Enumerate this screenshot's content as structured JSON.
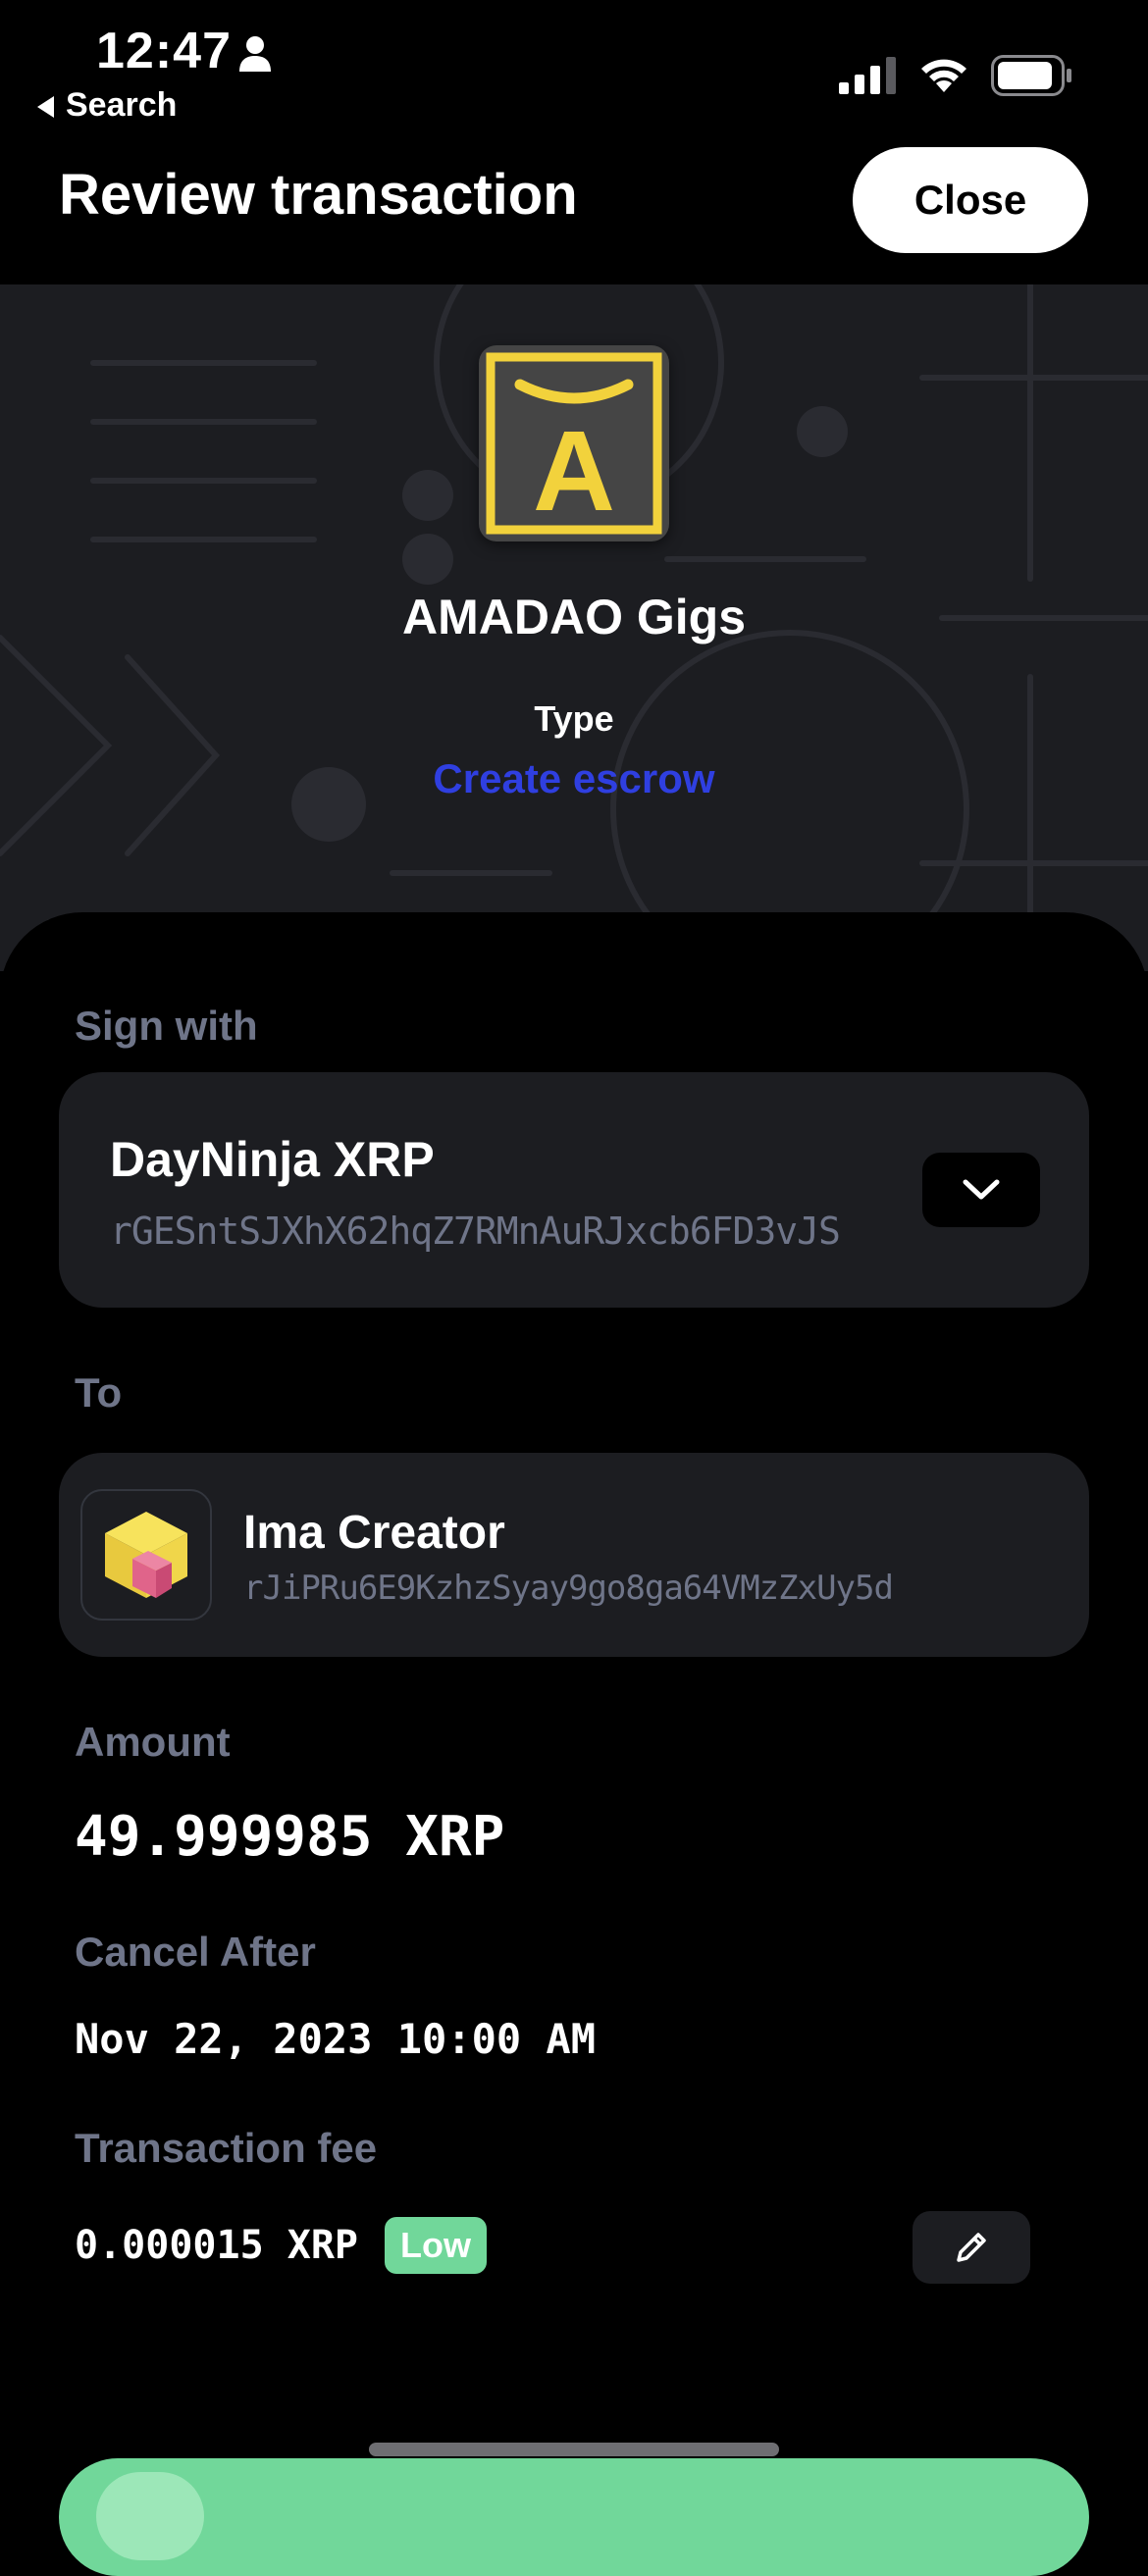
{
  "status_bar": {
    "time": "12:47",
    "back_label": "Search"
  },
  "header": {
    "title": "Review transaction",
    "close_label": "Close"
  },
  "app": {
    "name": "AMADAO Gigs",
    "type_label": "Type",
    "type_value": "Create escrow",
    "logo_letter": "A"
  },
  "sign_with": {
    "label": "Sign with",
    "account_name": "DayNinja XRP",
    "account_address": "rGESntSJXhX62hqZ7RMnAuRJxcb6FD3vJS"
  },
  "to": {
    "label": "To",
    "name": "Ima Creator",
    "address": "rJiPRu6E9KzhzSyay9go8ga64VMzZxUy5d"
  },
  "amount": {
    "label": "Amount",
    "value": "49.999985 XRP"
  },
  "cancel_after": {
    "label": "Cancel After",
    "value": "Nov 22, 2023 10:00 AM"
  },
  "fee": {
    "label": "Transaction fee",
    "value": "0.000015 XRP",
    "level": "Low"
  },
  "icons": [
    "person-icon",
    "signal-icon",
    "wifi-icon",
    "battery-icon",
    "chevron-down-icon",
    "pencil-icon"
  ],
  "colors": {
    "accent_blue": "#2f3fe0",
    "accent_green": "#71d79a",
    "logo_yellow": "#f2d23c",
    "muted": "#6f7589"
  }
}
